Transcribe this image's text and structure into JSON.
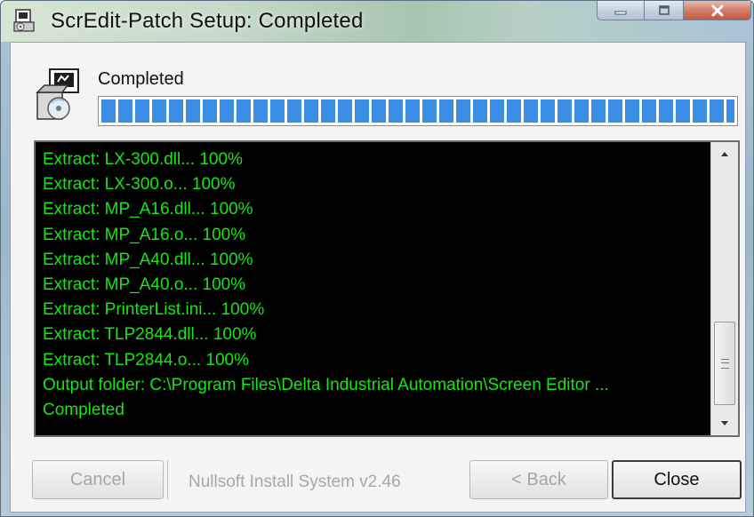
{
  "window": {
    "title": "ScrEdit-Patch Setup: Completed"
  },
  "header": {
    "status_label": "Completed",
    "progress_percent": 100
  },
  "log": {
    "lines": [
      "Extract: LX-300.dll... 100%",
      "Extract: LX-300.o... 100%",
      "Extract: MP_A16.dll... 100%",
      "Extract: MP_A16.o... 100%",
      "Extract: MP_A40.dll... 100%",
      "Extract: MP_A40.o... 100%",
      "Extract: PrinterList.ini... 100%",
      "Extract: TLP2844.dll... 100%",
      "Extract: TLP2844.o... 100%",
      "Output folder: C:\\Program Files\\Delta Industrial Automation\\Screen Editor ...",
      "Completed"
    ]
  },
  "footer": {
    "cancel_label": "Cancel",
    "branding": "Nullsoft Install System v2.46",
    "back_label": "< Back",
    "close_label": "Close"
  },
  "icons": {
    "title": "installer-icon",
    "header": "setup-package-icon",
    "minimize": "minimize-icon",
    "maximize": "maximize-icon",
    "close": "close-icon"
  },
  "colors": {
    "log_text": "#16e516",
    "log_background": "#000000",
    "progress": "#3a8ee6",
    "close_button": "#c4573f"
  }
}
